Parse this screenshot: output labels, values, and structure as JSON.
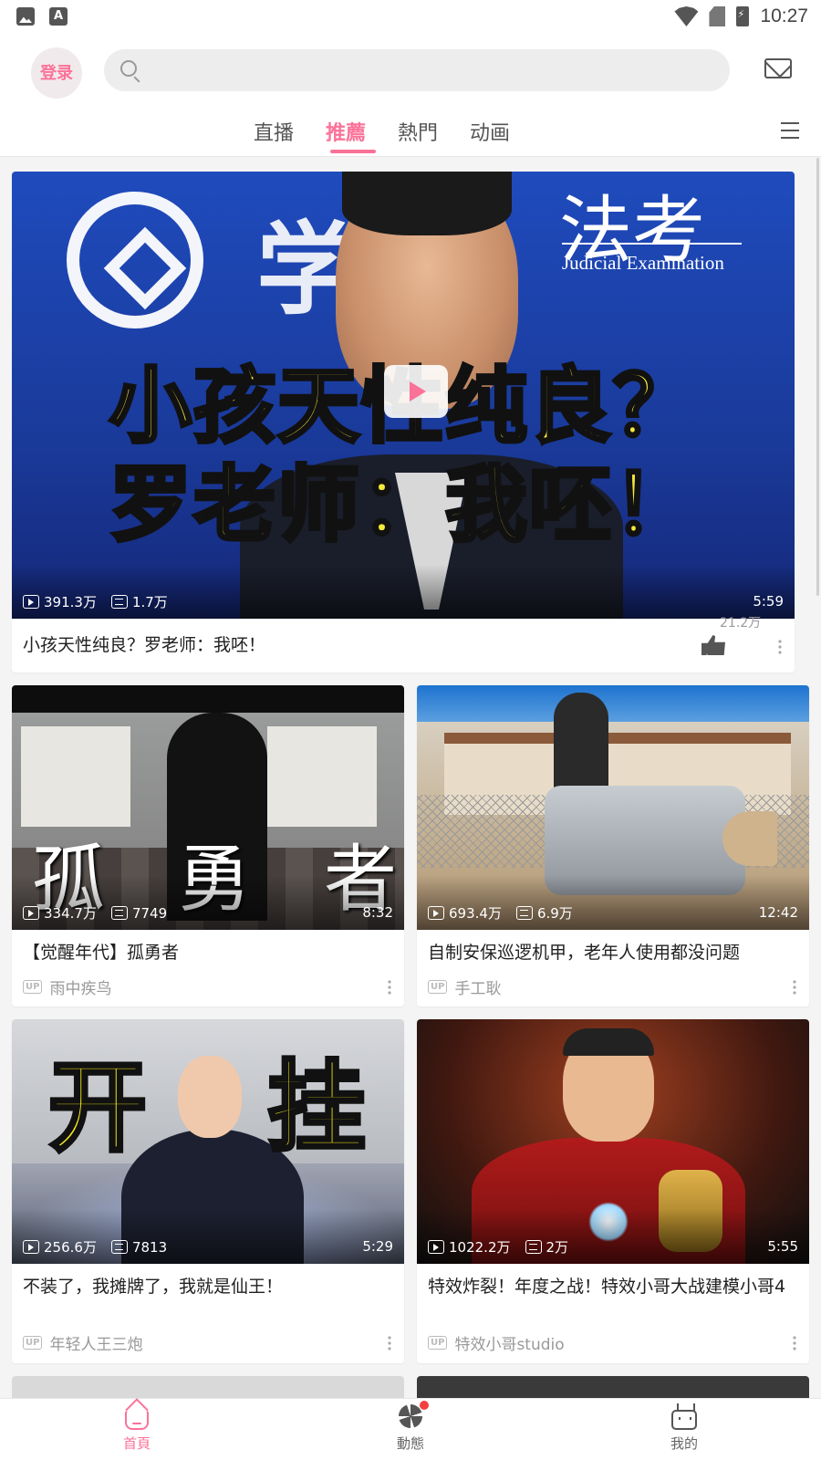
{
  "status_bar": {
    "time": "10:27",
    "left_icons": [
      "image-icon",
      "text-a-icon"
    ],
    "right_icons": [
      "wifi-icon",
      "no-sim-icon",
      "battery-charging-icon"
    ]
  },
  "header": {
    "login_label": "登录",
    "search_placeholder": "",
    "tabs": [
      {
        "label": "直播",
        "active": false
      },
      {
        "label": "推薦",
        "active": true
      },
      {
        "label": "熱門",
        "active": false
      },
      {
        "label": "动画",
        "active": false
      }
    ]
  },
  "featured": {
    "overlay_line1": "小孩天性纯良？",
    "overlay_line2": "罗老师：我呸！",
    "logo_text": "学",
    "brand_cn": "法考",
    "brand_en": "Judicial Examination",
    "views": "391.3万",
    "danmaku": "1.7万",
    "duration": "5:59",
    "title": "小孩天性纯良？罗老师：我呸！",
    "likes": "21.2万"
  },
  "videos": [
    {
      "thumb_text": [
        "孤",
        "勇",
        "者"
      ],
      "views": "334.7万",
      "danmaku": "7749",
      "duration": "8:32",
      "title": "【觉醒年代】孤勇者",
      "uploader": "雨中疾鸟"
    },
    {
      "views": "693.4万",
      "danmaku": "6.9万",
      "duration": "12:42",
      "title": "自制安保巡逻机甲，老年人使用都没问题",
      "uploader": "手工耿"
    },
    {
      "thumb_text": [
        "开",
        "挂"
      ],
      "views": "256.6万",
      "danmaku": "7813",
      "duration": "5:29",
      "title": "不装了，我摊牌了，我就是仙王！",
      "uploader": "年轻人王三炮"
    },
    {
      "views": "1022.2万",
      "danmaku": "2万",
      "duration": "5:55",
      "title": "特效炸裂！年度之战！特效小哥大战建模小哥4",
      "uploader": "特效小哥studio"
    }
  ],
  "up_badge": "UP",
  "bottom_nav": [
    {
      "label": "首頁",
      "icon": "home-icon",
      "active": true
    },
    {
      "label": "動態",
      "icon": "pinwheel-icon",
      "active": false,
      "has_notification": true
    },
    {
      "label": "我的",
      "icon": "tv-icon",
      "active": false
    }
  ],
  "colors": {
    "accent": "#fb7299",
    "background": "#f4f4f4",
    "notification": "#f43f3f"
  }
}
